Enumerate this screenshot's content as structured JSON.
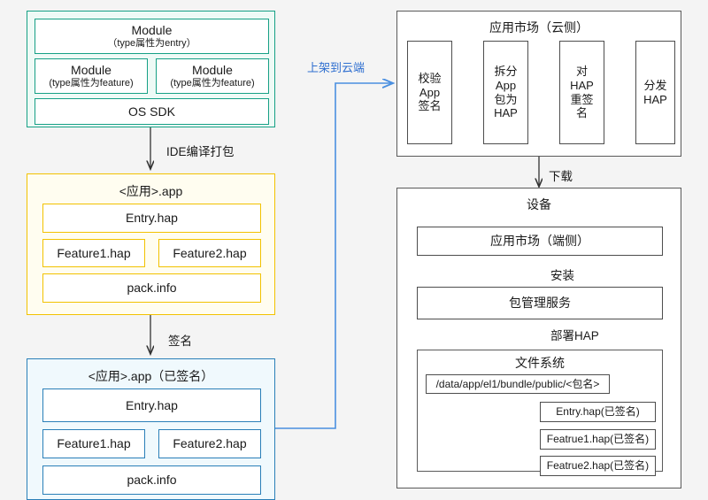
{
  "theme": {
    "background": "#f4f4f4",
    "teal": "#16a085",
    "teal_fill": "#eefaf6",
    "yellow": "#f2c200",
    "yellow_fill": "#fffdf0",
    "blue": "#2a7fb8",
    "blue_fill": "#f0f9fd",
    "grey": "#5a5a5a",
    "arrow_blue": "#2f6fd0",
    "arrow_dark": "#333333"
  },
  "project_group": {
    "entry_module": {
      "line1": "Module",
      "line2": "（type属性为entry）"
    },
    "feature_modules": [
      {
        "line1": "Module",
        "line2": "(type属性为feature)"
      },
      {
        "line1": "Module",
        "line2": "(type属性为feature)"
      }
    ],
    "sdk": "OS SDK"
  },
  "app_group": {
    "title": "<应用>.app",
    "entry": "Entry.hap",
    "features": [
      "Feature1.hap",
      "Feature2.hap"
    ],
    "pack": "pack.info"
  },
  "signed_app_group": {
    "title": "<应用>.app（已签名）",
    "entry": "Entry.hap",
    "features": [
      "Feature1.hap",
      "Feature2.hap"
    ],
    "pack": "pack.info"
  },
  "cloud_market": {
    "title": "应用市场（云侧）",
    "steps": [
      "校验\nApp\n签名",
      "拆分\nApp\n包为\nHAP",
      "对\nHAP\n重签\n名",
      "分发\nHAP"
    ]
  },
  "device": {
    "title": "设备",
    "market": "应用市场（端侧）",
    "package_manager": "包管理服务",
    "filesystem": {
      "title": "文件系统",
      "path": "/data/app/el1/bundle/public/<包名>",
      "files": [
        "Entry.hap(已签名)",
        "Featrue1.hap(已签名)",
        "Featrue2.hap(已签名)"
      ]
    }
  },
  "edges": {
    "ide_build": "IDE编译打包",
    "sign": "签名",
    "upload_cloud": "上架到云端",
    "download": "下载",
    "install": "安装",
    "deploy_hap": "部署HAP"
  }
}
